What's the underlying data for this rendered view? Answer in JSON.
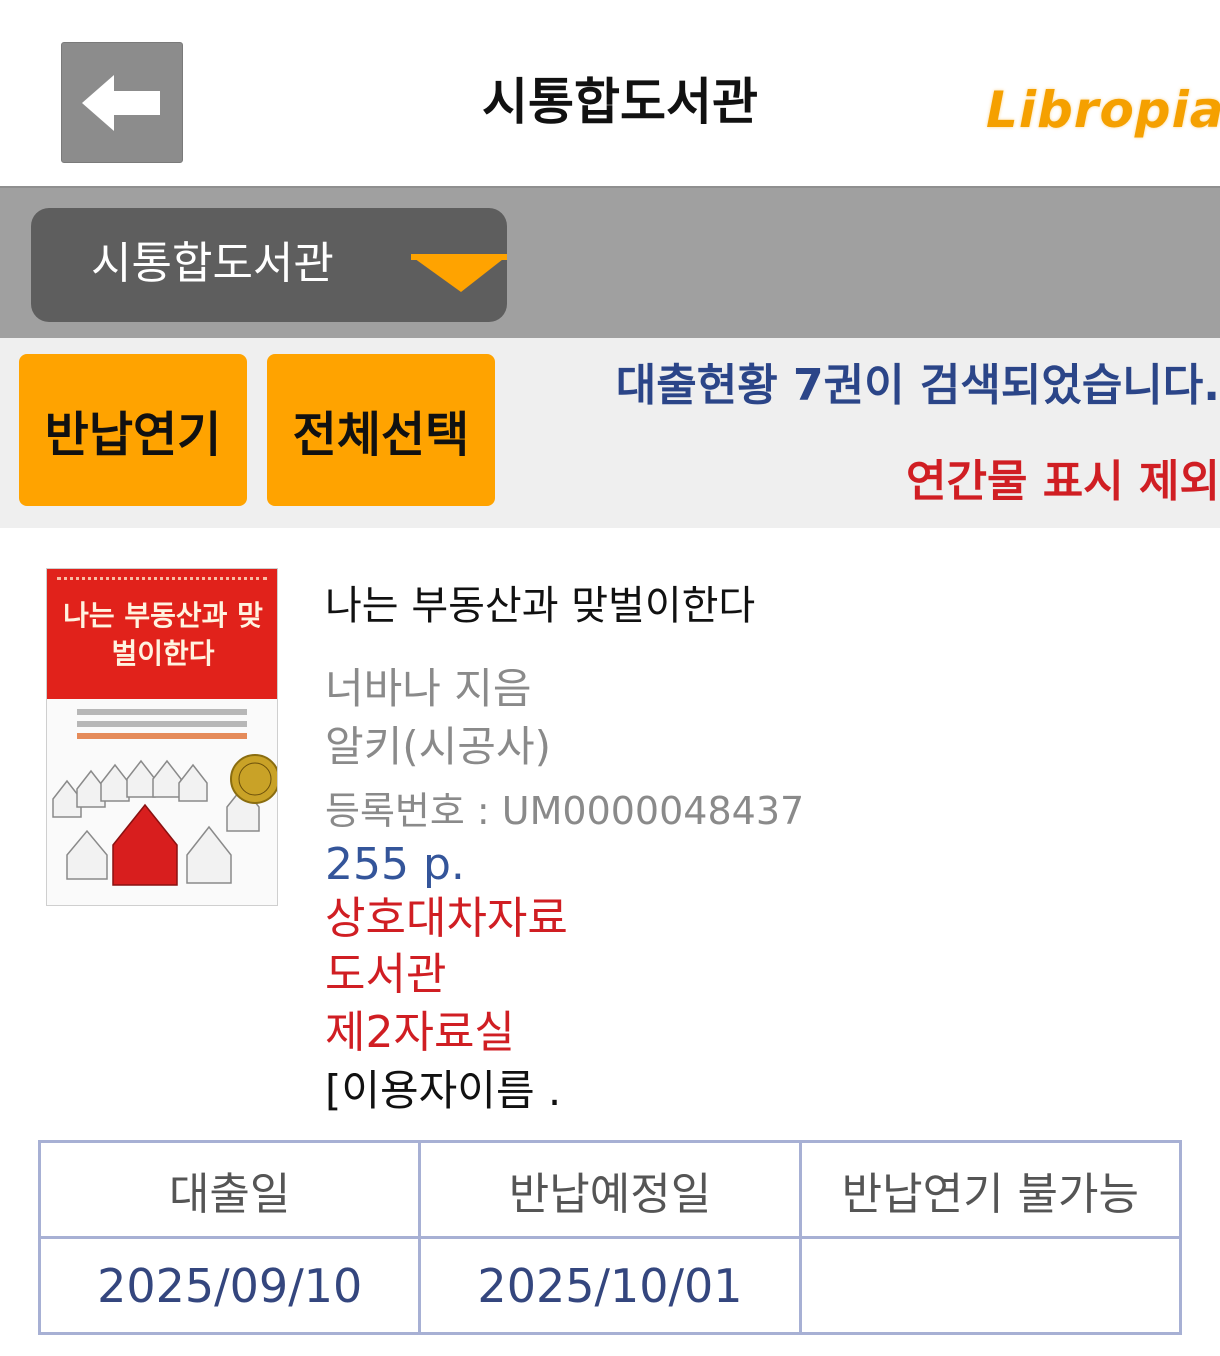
{
  "header": {
    "title": "시통합도서관",
    "logo_text": "Libropia"
  },
  "library_selector": {
    "label": "시통합도서관"
  },
  "actions": {
    "extend_label": "반납연기",
    "select_all_label": "전체선택"
  },
  "status": {
    "search_result": "대출현황 7권이 검색되었습니다.",
    "serial_note": "연간물 표시 제외"
  },
  "book": {
    "cover_title": "나는 부동산과 맞벌이한다",
    "title": "나는 부동산과 맞벌이한다",
    "author": "너바나 지음",
    "publisher": "알키(시공사)",
    "registration": "등록번호 : UM0000048437",
    "pages": "255 p.",
    "interlibrary": "상호대차자료",
    "library": "도서관",
    "room": "제2자료실",
    "user": "[이용자이름 ."
  },
  "loan_table": {
    "headers": [
      "대출일",
      "반납예정일",
      "반납연기 불가능"
    ],
    "values": [
      "2025/09/10",
      "2025/10/01",
      ""
    ]
  },
  "colors": {
    "accent_orange": "#ffa300",
    "logo_orange": "#f5a000",
    "status_blue": "#2b4588",
    "alert_red": "#d01e23",
    "table_border": "#a7b0d4"
  }
}
